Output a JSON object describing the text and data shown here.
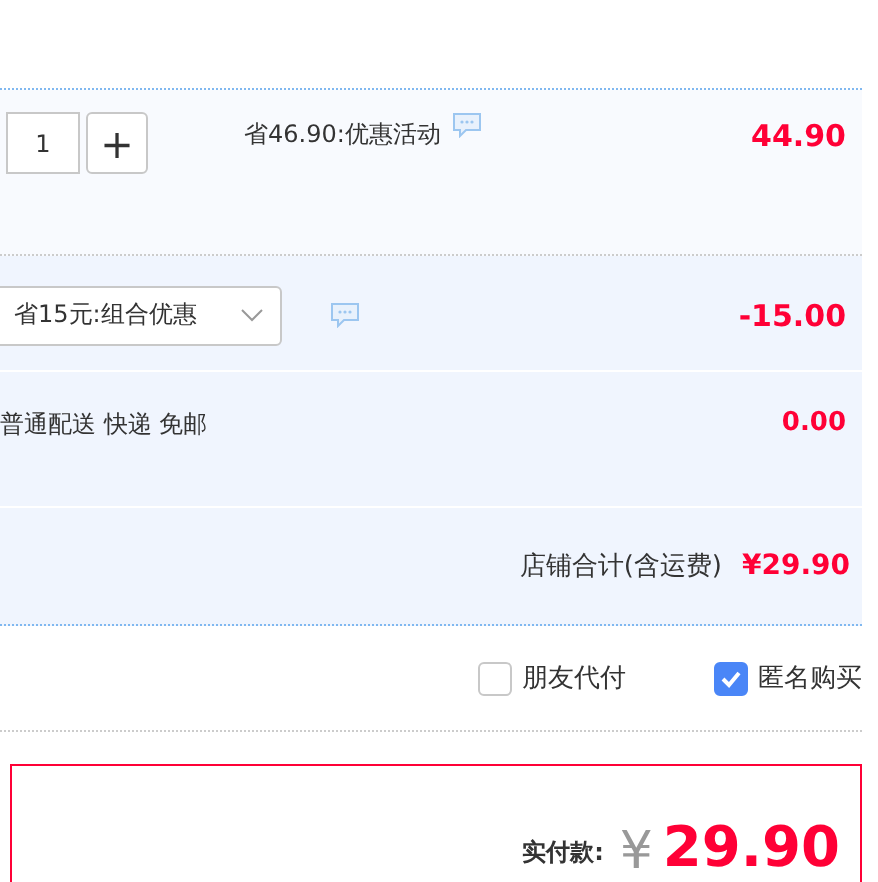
{
  "item": {
    "quantity": "1",
    "plus": "+",
    "promo": "省46.90:优惠活动",
    "price": "44.90"
  },
  "combo": {
    "selected_option": "省15元:组合优惠",
    "amount": "-15.00"
  },
  "shipping": {
    "method": "普通配送 快递 免邮",
    "amount": "0.00"
  },
  "total": {
    "label": "店铺合计(含运费)",
    "amount": "¥29.90"
  },
  "options": [
    {
      "label": "朋友代付",
      "checked": false
    },
    {
      "label": "匿名购买",
      "checked": true
    }
  ],
  "payment": {
    "label": "实付款:",
    "currency": "¥",
    "amount": "29.90"
  }
}
